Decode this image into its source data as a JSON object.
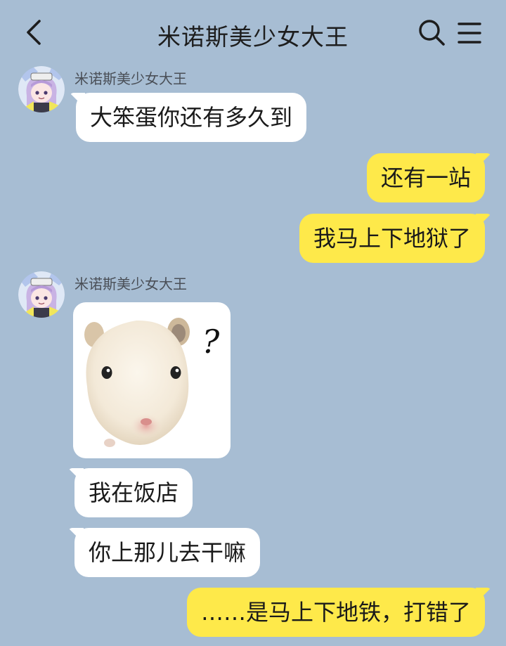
{
  "header": {
    "title": "米诺斯美少女大王",
    "back_icon": "chevron-left-icon",
    "search_icon": "search-icon",
    "menu_icon": "menu-icon"
  },
  "messages": [
    {
      "side": "in",
      "sender": "米诺斯美少女大王",
      "text": "大笨蛋你还有多久到"
    },
    {
      "side": "out",
      "text": "还有一站"
    },
    {
      "side": "out",
      "text": "我马上下地狱了"
    },
    {
      "side": "in",
      "sender": "米诺斯美少女大王",
      "sticker": "hamster-question-sticker"
    },
    {
      "side": "in",
      "text": "我在饭店"
    },
    {
      "side": "in",
      "text": "你上那儿去干嘛"
    },
    {
      "side": "out",
      "text": "……是马上下地铁，打错了"
    }
  ],
  "sticker": {
    "mark": "?"
  },
  "colors": {
    "background": "#a7bdd3",
    "incoming_bubble": "#ffffff",
    "outgoing_bubble": "#fee94a"
  }
}
